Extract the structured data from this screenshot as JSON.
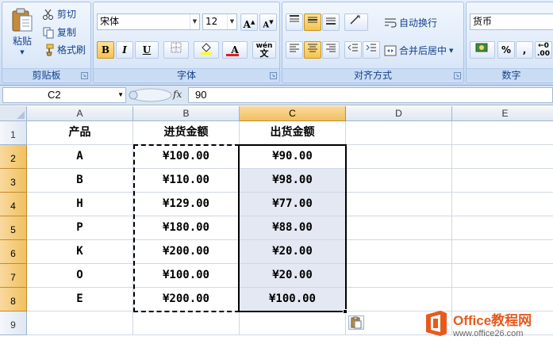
{
  "ribbon": {
    "clipboard": {
      "paste_label": "粘贴",
      "cut_label": "剪切",
      "copy_label": "复制",
      "format_painter_label": "格式刷",
      "group_label": "剪贴板"
    },
    "font": {
      "font_name": "宋体",
      "font_size": "12",
      "grow_label": "A",
      "shrink_label": "A",
      "bold_label": "B",
      "italic_label": "I",
      "underline_label": "U",
      "font_color_label": "A",
      "wen_label": "wén",
      "wen_char": "文",
      "group_label": "字体"
    },
    "alignment": {
      "wrap_text_label": "自动换行",
      "merge_center_label": "合并后居中",
      "group_label": "对齐方式"
    },
    "number": {
      "format_value": "货币",
      "percent_label": "%",
      "comma_label": ",",
      "group_label": "数字"
    }
  },
  "formula_bar": {
    "name_box": "C2",
    "fx_label": "fx",
    "formula": "90"
  },
  "grid": {
    "columns": [
      "A",
      "B",
      "C",
      "D",
      "E"
    ],
    "rows": [
      "1",
      "2",
      "3",
      "4",
      "5",
      "6",
      "7",
      "8",
      "9"
    ],
    "headers": [
      "产品",
      "进货金额",
      "出货金额"
    ],
    "data": [
      [
        "A",
        "¥100.00",
        "¥90.00"
      ],
      [
        "B",
        "¥110.00",
        "¥98.00"
      ],
      [
        "H",
        "¥129.00",
        "¥77.00"
      ],
      [
        "P",
        "¥180.00",
        "¥88.00"
      ],
      [
        "K",
        "¥200.00",
        "¥20.00"
      ],
      [
        "O",
        "¥100.00",
        "¥20.00"
      ],
      [
        "E",
        "¥200.00",
        "¥100.00"
      ]
    ]
  },
  "watermark": {
    "brand": "Office教程网",
    "url": "www.office26.com"
  },
  "colors": {
    "selected_header": "#f1c15f",
    "selection_fill": "#e4e8f3",
    "watermark_orange": "#e65a1e"
  }
}
